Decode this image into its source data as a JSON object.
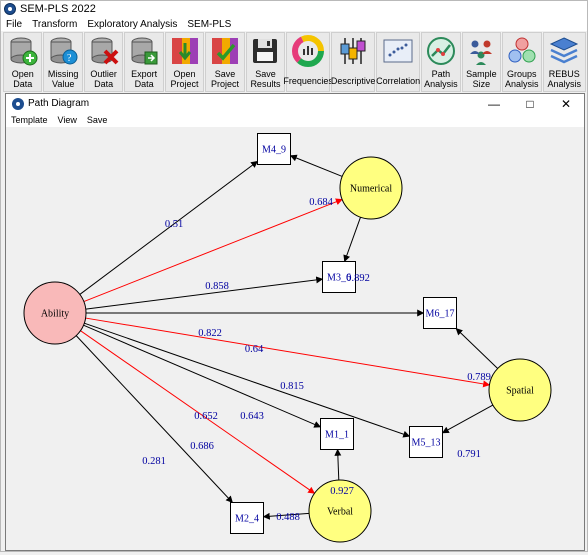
{
  "app": {
    "title": "SEM-PLS 2022"
  },
  "menu": [
    "File",
    "Transform",
    "Exploratory Analysis",
    "SEM-PLS"
  ],
  "toolbar": [
    {
      "label": "Open\nData",
      "icon": "open-data-icon"
    },
    {
      "label": "Missing\nValue",
      "icon": "missing-value-icon"
    },
    {
      "label": "Outlier\nData",
      "icon": "outlier-data-icon"
    },
    {
      "label": "Export\nData",
      "icon": "export-data-icon"
    },
    {
      "label": "Open\nProject",
      "icon": "open-project-icon"
    },
    {
      "label": "Save\nProject",
      "icon": "save-project-icon"
    },
    {
      "label": "Save\nResults",
      "icon": "save-results-icon"
    },
    {
      "label": "Frequencies",
      "icon": "frequencies-icon"
    },
    {
      "label": "Descriptive",
      "icon": "descriptive-icon"
    },
    {
      "label": "Correlation",
      "icon": "correlation-icon"
    },
    {
      "label": "Path\nAnalysis",
      "icon": "path-analysis-icon"
    },
    {
      "label": "Sample\nSize",
      "icon": "sample-size-icon"
    },
    {
      "label": "Groups\nAnalysis",
      "icon": "groups-analysis-icon"
    },
    {
      "label": "REBUS\nAnalysis",
      "icon": "rebus-analysis-icon"
    }
  ],
  "window": {
    "title": "Path Diagram",
    "menu": [
      "Template",
      "View",
      "Save"
    ]
  },
  "colors": {
    "ability_fill": "#f9b9b9",
    "construct_fill": "#ffff80",
    "edge_black": "#000000",
    "edge_red": "#ff0000",
    "coef_text": "#0000a0",
    "indicator_text": "#0000a0"
  },
  "diagram": {
    "nodes": [
      {
        "id": "Ability",
        "label": "Ability",
        "type": "latent",
        "fill": "#f9b9b9"
      },
      {
        "id": "Numerical",
        "label": "Numerical",
        "type": "latent",
        "fill": "#ffff80"
      },
      {
        "id": "Spatial",
        "label": "Spatial",
        "type": "latent",
        "fill": "#ffff80"
      },
      {
        "id": "Verbal",
        "label": "Verbal",
        "type": "latent",
        "fill": "#ffff80"
      },
      {
        "id": "M4_9",
        "label": "M4_9",
        "type": "indicator"
      },
      {
        "id": "M3_6",
        "label": "M3_6",
        "type": "indicator"
      },
      {
        "id": "M6_17",
        "label": "M6_17",
        "type": "indicator"
      },
      {
        "id": "M1_1",
        "label": "M1_1",
        "type": "indicator"
      },
      {
        "id": "M5_13",
        "label": "M5_13",
        "type": "indicator"
      },
      {
        "id": "M2_4",
        "label": "M2_4",
        "type": "indicator"
      }
    ],
    "edges": [
      {
        "from": "Ability",
        "to": "M4_9",
        "value": "0.51",
        "color": "black"
      },
      {
        "from": "Ability",
        "to": "Numerical",
        "value": "0.858",
        "color": "red"
      },
      {
        "from": "Ability",
        "to": "M3_6",
        "value": "0.822",
        "color": "black"
      },
      {
        "from": "Ability",
        "to": "M6_17",
        "value": "0.64",
        "color": "black"
      },
      {
        "from": "Ability",
        "to": "Spatial",
        "value": "0.815",
        "color": "red"
      },
      {
        "from": "Ability",
        "to": "M1_1",
        "value": "0.652",
        "color": "black"
      },
      {
        "from": "Ability",
        "to": "M5_13",
        "value": "0.643",
        "color": "black"
      },
      {
        "from": "Ability",
        "to": "Verbal",
        "value": "0.686",
        "color": "red"
      },
      {
        "from": "Ability",
        "to": "M2_4",
        "value": "0.281",
        "color": "black"
      },
      {
        "from": "Numerical",
        "to": "M4_9",
        "value": "0.684",
        "color": "black"
      },
      {
        "from": "Numerical",
        "to": "M3_6",
        "value": "0.892",
        "color": "black"
      },
      {
        "from": "Spatial",
        "to": "M6_17",
        "value": "0.789",
        "color": "black"
      },
      {
        "from": "Spatial",
        "to": "M5_13",
        "value": "0.791",
        "color": "black"
      },
      {
        "from": "Verbal",
        "to": "M1_1",
        "value": "0.927",
        "color": "black"
      },
      {
        "from": "Verbal",
        "to": "M2_4",
        "value": "0.488",
        "color": "black"
      }
    ]
  }
}
